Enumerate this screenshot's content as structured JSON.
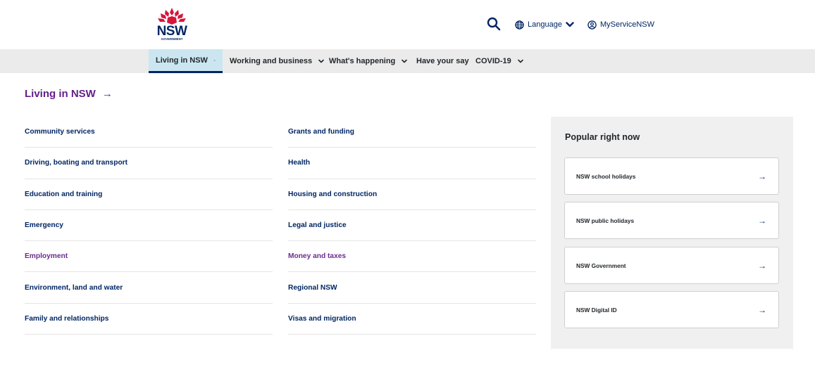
{
  "header": {
    "logo": {
      "wordmark": "NSW",
      "subtext": "GOVERNMENT"
    },
    "search_icon": "search-icon",
    "language_label": "Language",
    "account_label": "MyServiceNSW"
  },
  "nav": {
    "items": [
      {
        "label": "Living in NSW",
        "active": true,
        "chevron": "up"
      },
      {
        "label": "Working and business",
        "active": false,
        "chevron": "down"
      },
      {
        "label": "What's happening",
        "active": false,
        "chevron": "down"
      },
      {
        "label": "Have your say",
        "active": false,
        "chevron": null
      },
      {
        "label": "COVID-19",
        "active": false,
        "chevron": "down"
      }
    ]
  },
  "menu": {
    "title": "Living in NSW",
    "title_arrow": "→",
    "left_links": [
      "Community services",
      "Driving, boating and transport",
      "Education and training",
      "Emergency",
      "Employment",
      "Environment, land and water",
      "Family and relationships"
    ],
    "right_links": [
      "Grants and funding",
      "Health",
      "Housing and construction",
      "Legal and justice",
      "Money and taxes",
      "Regional NSW",
      "Visas and migration"
    ],
    "visited": [
      "Employment",
      "Money and taxes"
    ]
  },
  "popular": {
    "title": "Popular right now",
    "items": [
      "NSW school holidays",
      "NSW public holidays",
      "NSW Government",
      "NSW Digital ID"
    ],
    "arrow": "→"
  },
  "colors": {
    "brand_navy": "#002664",
    "visited_purple": "#631f8a",
    "nav_bg": "#ebebeb",
    "nav_active_bg": "#cbe6f0",
    "waratah_red": "#d7153a",
    "panel_bg": "#f0f0f0"
  }
}
